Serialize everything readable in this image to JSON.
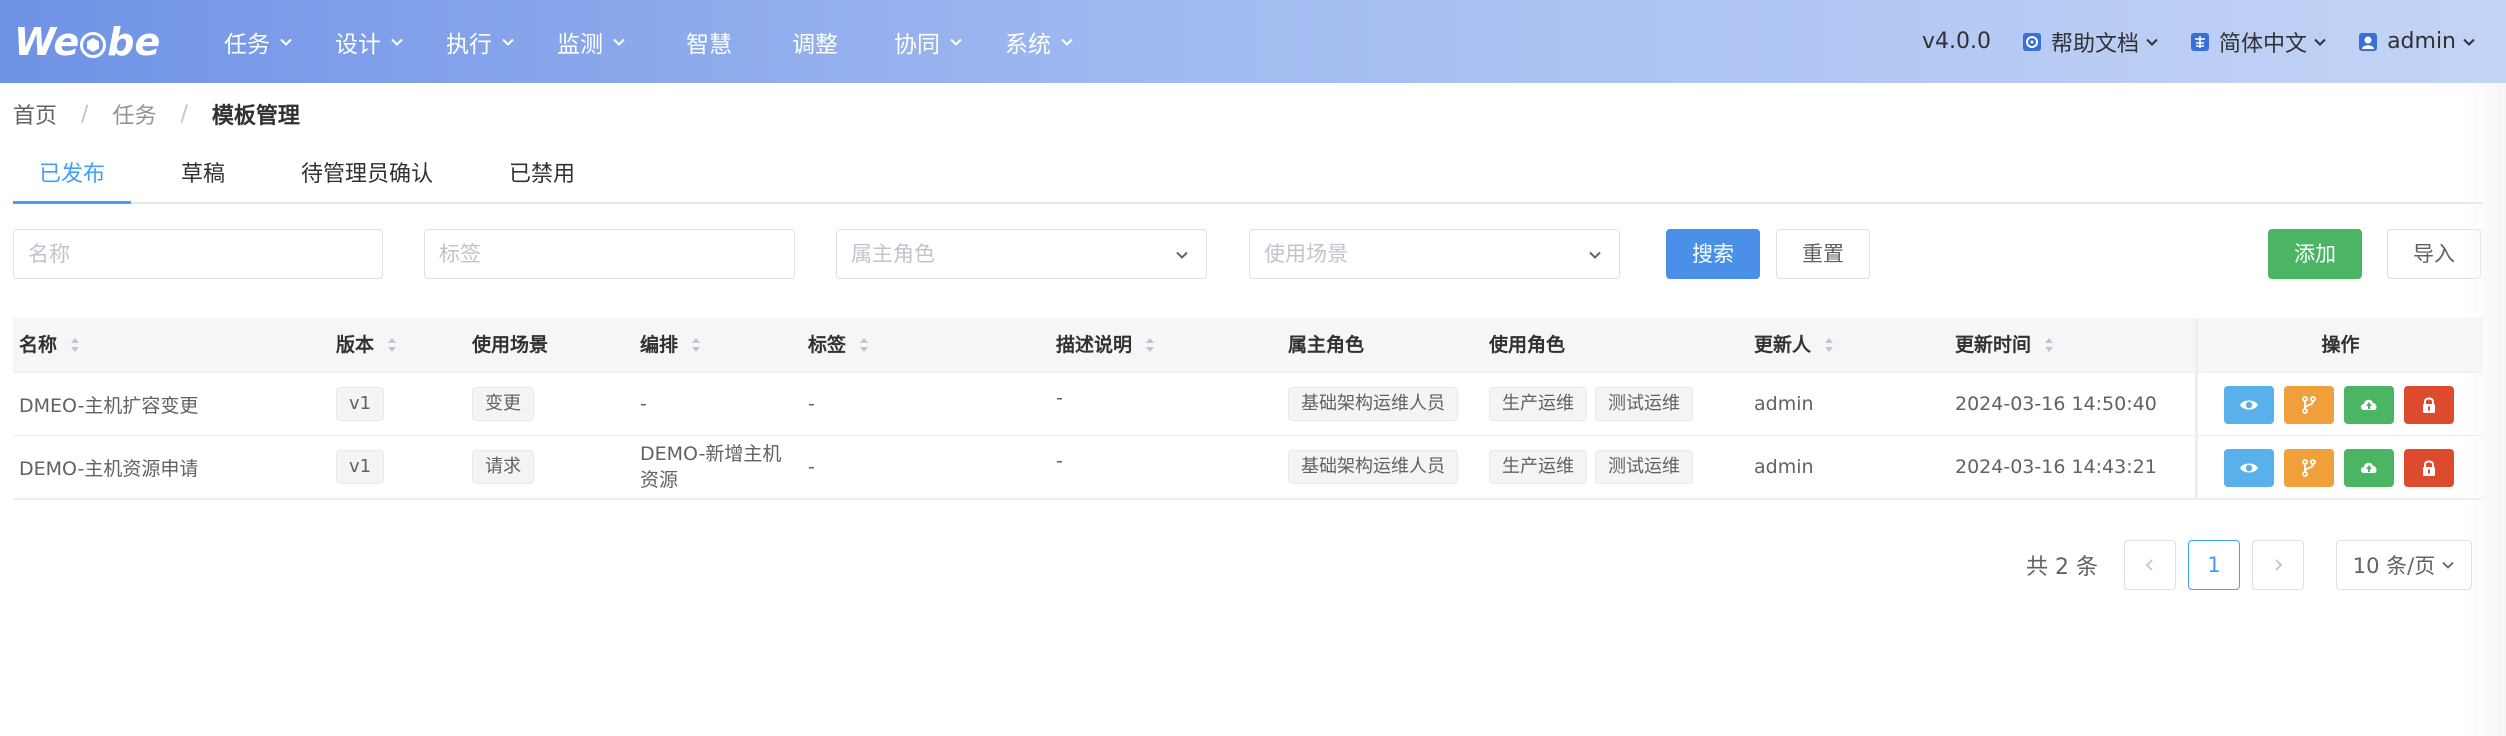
{
  "header": {
    "logo": "WeCube",
    "nav": [
      {
        "label": "任务",
        "has_dropdown": true
      },
      {
        "label": "设计",
        "has_dropdown": true
      },
      {
        "label": "执行",
        "has_dropdown": true
      },
      {
        "label": "监测",
        "has_dropdown": true
      },
      {
        "label": "智慧",
        "has_dropdown": false
      },
      {
        "label": "调整",
        "has_dropdown": false
      },
      {
        "label": "协同",
        "has_dropdown": true
      },
      {
        "label": "系统",
        "has_dropdown": true
      }
    ],
    "version": "v4.0.0",
    "help": "帮助文档",
    "language": "简体中文",
    "user": "admin"
  },
  "breadcrumb": [
    "首页",
    "任务",
    "模板管理"
  ],
  "tabs": [
    "已发布",
    "草稿",
    "待管理员确认",
    "已禁用"
  ],
  "active_tab": 0,
  "filter": {
    "name_placeholder": "名称",
    "tag_placeholder": "标签",
    "role_placeholder": "属主角色",
    "scene_placeholder": "使用场景",
    "search_label": "搜索",
    "reset_label": "重置",
    "add_label": "添加",
    "import_label": "导入"
  },
  "table": {
    "headers": [
      "名称",
      "版本",
      "使用场景",
      "编排",
      "标签",
      "描述说明",
      "属主角色",
      "使用角色",
      "更新人",
      "更新时间",
      "操作"
    ],
    "rows": [
      {
        "name": "DMEO-主机扩容变更",
        "version": "v1",
        "scene": "变更",
        "orchestration": "-",
        "tags": "-",
        "description": "-",
        "owner_role": "基础架构运维人员",
        "use_roles": [
          "生产运维",
          "测试运维"
        ],
        "updated_by": "admin",
        "updated_at": "2024-03-16 14:50:40"
      },
      {
        "name": "DEMO-主机资源申请",
        "version": "v1",
        "scene": "请求",
        "orchestration": "DEMO-新增主机资源",
        "tags": "-",
        "description": "-",
        "owner_role": "基础架构运维人员",
        "use_roles": [
          "生产运维",
          "测试运维"
        ],
        "updated_by": "admin",
        "updated_at": "2024-03-16 14:43:21"
      }
    ],
    "action_icons": [
      "eye-icon",
      "branch-icon",
      "cloud-upload-icon",
      "lock-icon"
    ],
    "action_colors": [
      "#5ab0ea",
      "#f0a03a",
      "#4cb564",
      "#dd4a2d"
    ]
  },
  "pagination": {
    "total_text": "共 2 条",
    "current_page": "1",
    "page_size": "10 条/页"
  },
  "colors": {
    "primary": "#4a8fe8",
    "success": "#4cb564",
    "header_start": "#6f92e6",
    "header_end": "#c4d4f6"
  }
}
